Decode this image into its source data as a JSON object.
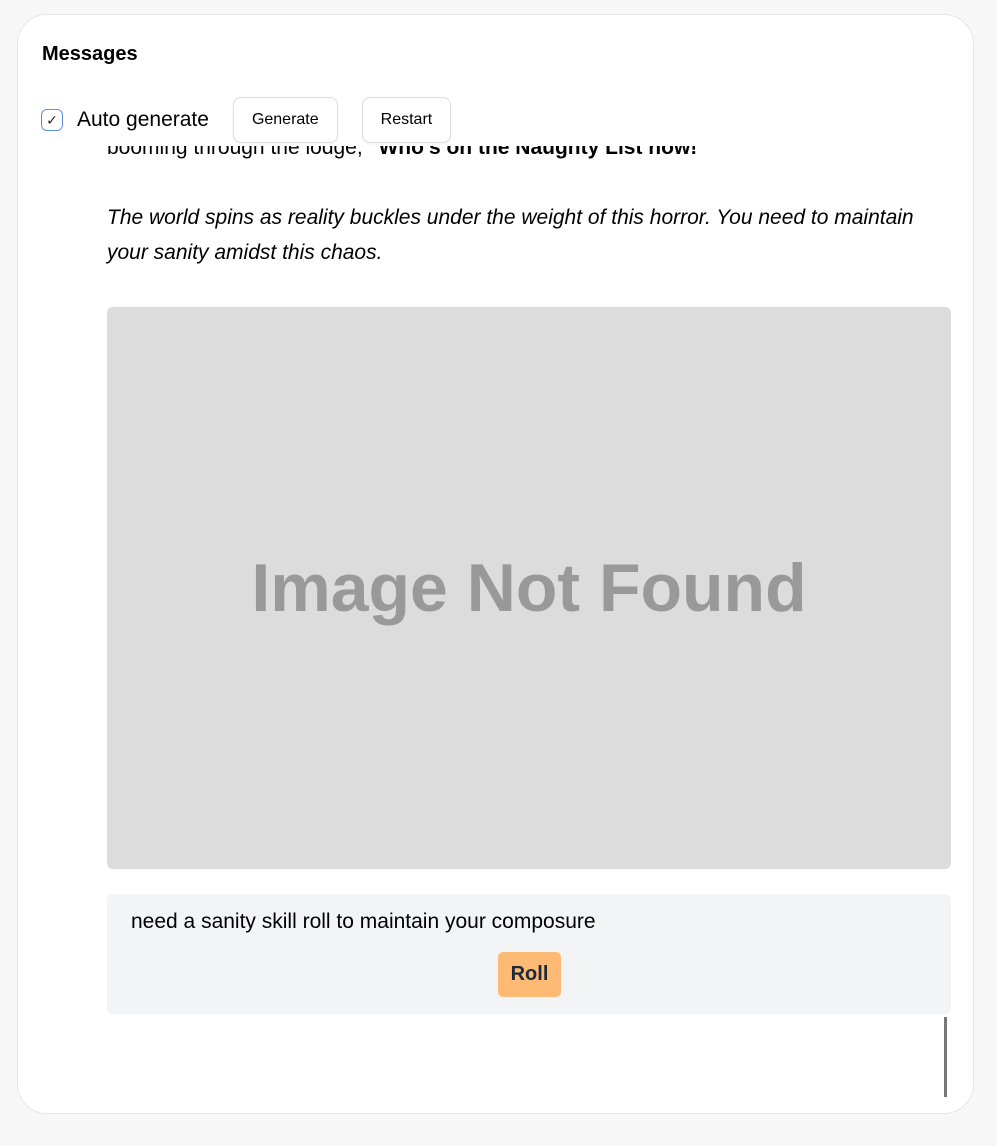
{
  "panel": {
    "title": "Messages"
  },
  "toolbar": {
    "auto_generate_label": "Auto generate",
    "auto_generate_checked": true,
    "generate_label": "Generate",
    "restart_label": "Restart"
  },
  "message": {
    "line1_plain": "booming through the lodge, ",
    "line1_bold": "\"Who's on the Naughty List now!\"",
    "italic": "The world spins as reality buckles under the weight of this horror. You need to maintain your sanity amidst this chaos.",
    "image_placeholder": "Image Not Found"
  },
  "roll": {
    "prompt": "need a sanity skill roll to maintain your composure",
    "button_label": "Roll"
  },
  "colors": {
    "roll_button": "#fdba74",
    "image_bg": "#dcdcdc",
    "roll_box_bg": "#f3f4f6"
  }
}
